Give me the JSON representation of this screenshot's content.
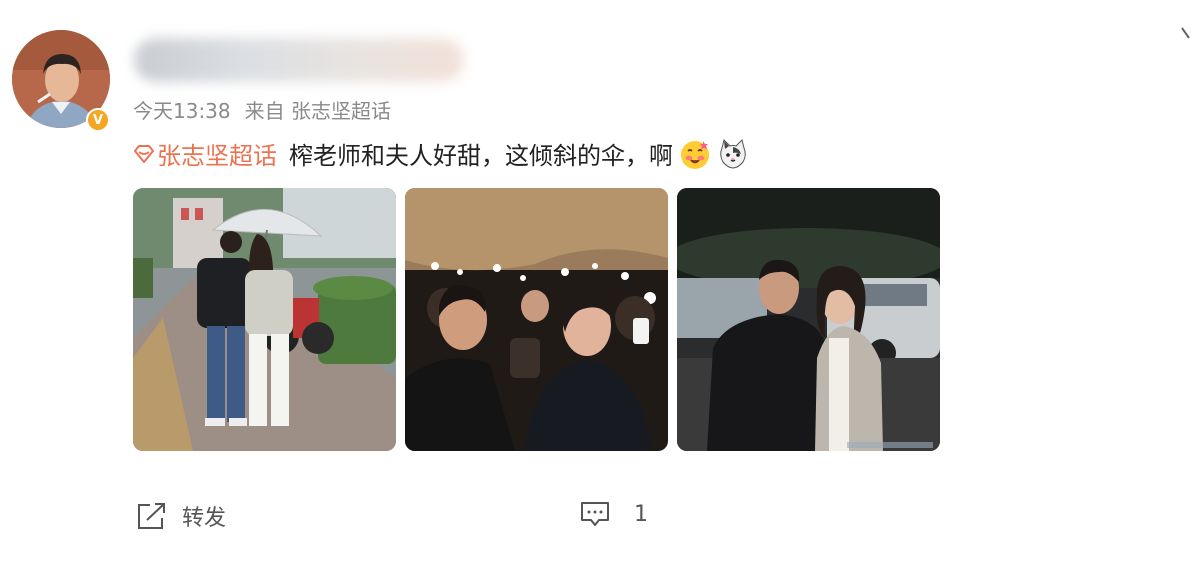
{
  "post": {
    "time": "今天13:38",
    "source": "来自 张志坚超话",
    "topic": "张志坚超话",
    "text": "榨老师和夫人好甜，这倾斜的伞，啊"
  },
  "actions": {
    "repost_label": "转发",
    "comment_count": "1"
  },
  "colors": {
    "topic": "#eb7350",
    "meta": "#8a8a8a",
    "verified_badge": "#f5a623"
  }
}
